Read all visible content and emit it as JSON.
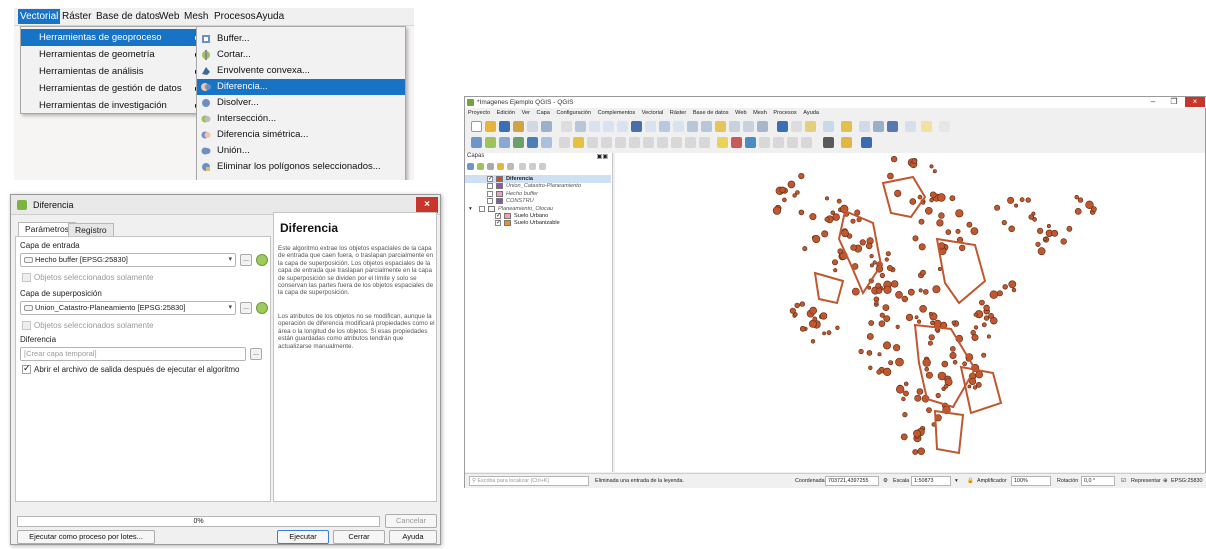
{
  "menu_shot": {
    "menubar": [
      "Vectorial",
      "Ráster",
      "Base de datos",
      "Web",
      "Mesh",
      "Procesos",
      "Ayuda"
    ],
    "vector_submenu": [
      "Herramientas de geoproceso",
      "Herramientas de geometría",
      "Herramientas de análisis",
      "Herramientas de gestión de datos",
      "Herramientas de investigación"
    ],
    "geoprocess_items": [
      "Buffer...",
      "Cortar...",
      "Envolvente convexa...",
      "Diferencia...",
      "Disolver...",
      "Intersección...",
      "Diferencia simétrica...",
      "Unión...",
      "Eliminar los polígonos seleccionados..."
    ],
    "selected_submenu": "Herramientas de geoproceso",
    "selected_item": "Diferencia..."
  },
  "dialog": {
    "title": "Diferencia",
    "tabs": [
      "Parámetros",
      "Registro"
    ],
    "input_label": "Capa de entrada",
    "input_value": "Hecho buffer [EPSG:25830]",
    "selected_only_1": "Objetos seleccionados solamente",
    "overlay_label": "Capa de superposición",
    "overlay_value": "Union_Catastro-Planeamiento [EPSG:25830]",
    "selected_only_2": "Objetos seleccionados solamente",
    "output_label": "Diferencia",
    "output_placeholder": "[Crear capa temporal]",
    "open_output": "Abrir el archivo de salida después de ejecutar el algoritmo",
    "help_title": "Diferencia",
    "help_p1": "Este algoritmo extrae los objetos espaciales de la capa de entrada que caen fuera, o traslapan parcialmente en la capa de superposición. Los objetos espaciales de la capa de entrada que traslapan parcialmente en la capa de superposición se dividen por el límite y solo se conservan las partes fuera de los objetos espaciales de la capa de superposición.",
    "help_p2": "Los atributos de los objetos no se modifican, aunque la operación de diferencia modificará propiedades como el área o la longitud de los objetos. Si esas propiedades están guardadas como atributos tendrán que actualizarse manualmente.",
    "progress": "0%",
    "progress_value": 0,
    "cancel": "Cancelar",
    "batch": "Ejecutar como proceso por lotes...",
    "run": "Ejecutar",
    "close": "Cerrar",
    "help": "Ayuda",
    "browse": "..."
  },
  "qgis": {
    "title": "*Imagenes Ejemplo QGIS - QGIS",
    "menu": [
      "Proyecto",
      "Edición",
      "Ver",
      "Capa",
      "Configuración",
      "Complementos",
      "Vectorial",
      "Ráster",
      "Base de datos",
      "Web",
      "Mesh",
      "Procesos",
      "Ayuda"
    ],
    "layers_header": "Capas",
    "layers": [
      {
        "name": "Diferencia",
        "checked": true,
        "color": "#c0532e",
        "selected": true,
        "indent": 1
      },
      {
        "name": "Union_Catastro-Planeamiento",
        "checked": false,
        "color": "#8e5a9c",
        "indent": 1
      },
      {
        "name": "Hecho buffer",
        "checked": false,
        "color": "#e9a0c2",
        "indent": 1
      },
      {
        "name": "CONSTRU",
        "checked": false,
        "color": "#7a5fa8",
        "indent": 1
      },
      {
        "name": "Planeamiento_Olocau",
        "checked": false,
        "color": "",
        "indent": 0,
        "group": true
      },
      {
        "name": "Suelo Urbano",
        "checked": true,
        "color": "#f2a0b2",
        "indent": 2
      },
      {
        "name": "Suelo Urbanizable",
        "checked": true,
        "color": "#f28c1e",
        "indent": 2
      }
    ],
    "search_placeholder": "Escriba para localizar (Ctrl+K)",
    "status_msg": "Eliminada una entrada de la leyenda.",
    "coord_label": "Coordenada",
    "coord_value": "703721,4397255",
    "scale_label": "Escala",
    "scale_value": "1:50873",
    "magnifier_label": "Amplificador",
    "magnifier_value": "100%",
    "rotation_label": "Rotación",
    "rotation_value": "0,0 °",
    "render_label": "Representar",
    "crs": "EPSG:25830",
    "map_fill": "#c0572f",
    "map_stroke": "#5c2a12"
  }
}
